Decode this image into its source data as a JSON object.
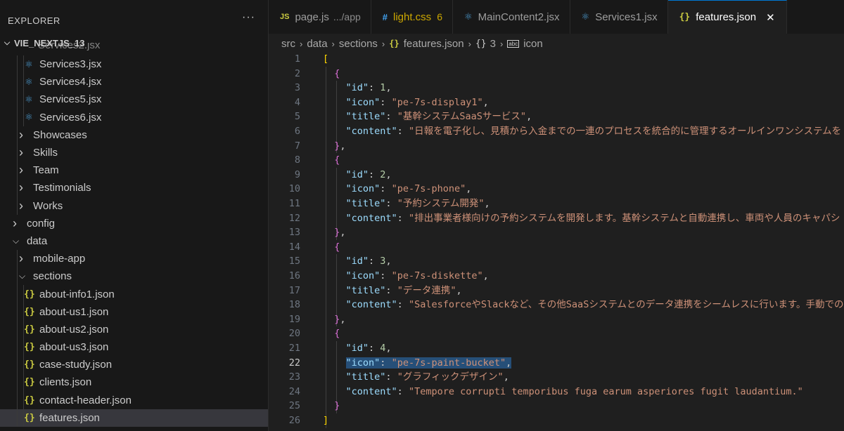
{
  "sidebar": {
    "title": "EXPLORER",
    "more": "···",
    "root": "VIE_NEXTJS_13",
    "partial_item": "Services2.jsx",
    "items": [
      {
        "label": "Services3.jsx",
        "type": "react",
        "depth": 2
      },
      {
        "label": "Services4.jsx",
        "type": "react",
        "depth": 2
      },
      {
        "label": "Services5.jsx",
        "type": "react",
        "depth": 2
      },
      {
        "label": "Services6.jsx",
        "type": "react",
        "depth": 2
      },
      {
        "label": "Showcases",
        "type": "folder",
        "depth": 1
      },
      {
        "label": "Skills",
        "type": "folder",
        "depth": 1
      },
      {
        "label": "Team",
        "type": "folder",
        "depth": 1
      },
      {
        "label": "Testimonials",
        "type": "folder",
        "depth": 1
      },
      {
        "label": "Works",
        "type": "folder",
        "depth": 1
      },
      {
        "label": "config",
        "type": "folder",
        "depth": 0
      },
      {
        "label": "data",
        "type": "folder-open",
        "depth": 0
      },
      {
        "label": "mobile-app",
        "type": "folder",
        "depth": 1
      },
      {
        "label": "sections",
        "type": "folder-open",
        "depth": 1
      },
      {
        "label": "about-info1.json",
        "type": "json",
        "depth": 2
      },
      {
        "label": "about-us1.json",
        "type": "json",
        "depth": 2
      },
      {
        "label": "about-us2.json",
        "type": "json",
        "depth": 2
      },
      {
        "label": "about-us3.json",
        "type": "json",
        "depth": 2
      },
      {
        "label": "case-study.json",
        "type": "json",
        "depth": 2
      },
      {
        "label": "clients.json",
        "type": "json",
        "depth": 2
      },
      {
        "label": "contact-header.json",
        "type": "json",
        "depth": 2
      },
      {
        "label": "features.json",
        "type": "json",
        "depth": 2,
        "selected": true
      }
    ]
  },
  "tabs": [
    {
      "icon": "js-icon",
      "icon_text": "JS",
      "label": "page.js",
      "detail": ".../app"
    },
    {
      "icon": "css-icon",
      "icon_text": "#",
      "label": "light.css",
      "count": "6"
    },
    {
      "icon": "react-icon",
      "icon_text": "⚛",
      "label": "MainContent2.jsx"
    },
    {
      "icon": "react-icon",
      "icon_text": "⚛",
      "label": "Services1.jsx"
    },
    {
      "icon": "json-icon",
      "icon_text": "{}",
      "label": "features.json",
      "active": true,
      "close": "✕"
    }
  ],
  "breadcrumb": {
    "parts": [
      "src",
      "data",
      "sections"
    ],
    "file_icon": "{}",
    "file": "features.json",
    "symbol_icon": "{}",
    "symbol": "3",
    "prop_icon": "abc",
    "prop": "icon"
  },
  "editor": {
    "current_line": 22,
    "lines": [
      "[",
      "  {",
      "    \"id\": 1,",
      "    \"icon\": \"pe-7s-display1\",",
      "    \"title\": \"基幹システムSaaSサービス\",",
      "    \"content\": \"日報を電子化し、見積から入金までの一連のプロセスを統合的に管理するオールインワンシステムを",
      "  },",
      "  {",
      "    \"id\": 2,",
      "    \"icon\": \"pe-7s-phone\",",
      "    \"title\": \"予約システム開発\",",
      "    \"content\": \"排出事業者様向けの予約システムを開発します。基幹システムと自動連携し、車両や人員のキャパシ",
      "  },",
      "  {",
      "    \"id\": 3,",
      "    \"icon\": \"pe-7s-diskette\",",
      "    \"title\": \"データ連携\",",
      "    \"content\": \"SalesforceやSlackなど、その他SaaSシステムとのデータ連携をシームレスに行います。手動での",
      "  },",
      "  {",
      "    \"id\": 4,",
      "    \"icon\": \"pe-7s-paint-bucket\",",
      "    \"title\": \"グラフィックデザイン\",",
      "    \"content\": \"Tempore corrupti temporibus fuga earum asperiores fugit laudantium.\"",
      "  }",
      "]"
    ]
  }
}
